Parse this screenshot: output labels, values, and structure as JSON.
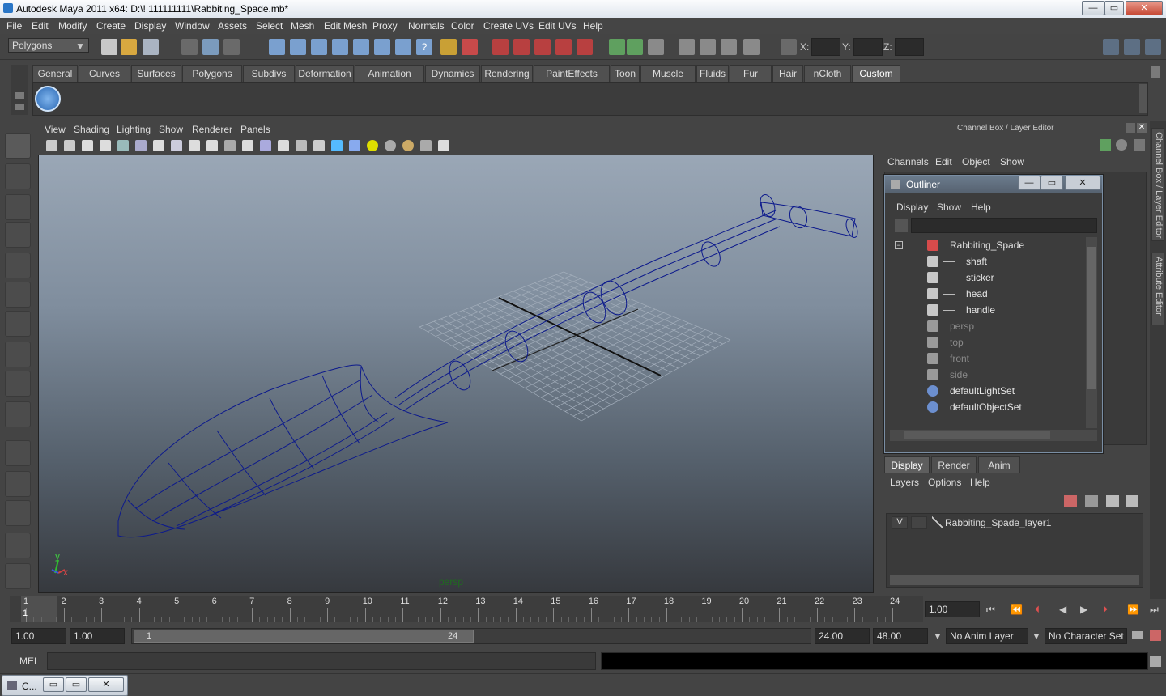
{
  "title": "Autodesk Maya 2011 x64: D:\\! 111111111\\Rabbiting_Spade.mb*",
  "window_buttons": {
    "min": "—",
    "max": "▭",
    "close": "✕"
  },
  "menus": [
    "File",
    "Edit",
    "Modify",
    "Create",
    "Display",
    "Window",
    "Assets",
    "Select",
    "Mesh",
    "Edit Mesh",
    "Proxy",
    "Normals",
    "Color",
    "Create UVs",
    "Edit UVs",
    "Help"
  ],
  "mode_select": "Polygons",
  "coords": {
    "x_label": "X:",
    "y_label": "Y:",
    "z_label": "Z:"
  },
  "shelf_tabs": [
    "General",
    "Curves",
    "Surfaces",
    "Polygons",
    "Subdivs",
    "Deformation",
    "Animation",
    "Dynamics",
    "Rendering",
    "PaintEffects",
    "Toon",
    "Muscle",
    "Fluids",
    "Fur",
    "Hair",
    "nCloth",
    "Custom"
  ],
  "active_shelf": "Custom",
  "viewport_menus": [
    "View",
    "Shading",
    "Lighting",
    "Show",
    "Renderer",
    "Panels"
  ],
  "camera_label": "persp",
  "axis": {
    "y": "y",
    "x": "x"
  },
  "channel_box": {
    "title": "Channel Box / Layer Editor",
    "menus": [
      "Channels",
      "Edit",
      "Object",
      "Show"
    ]
  },
  "outliner": {
    "title": "Outliner",
    "menus": [
      "Display",
      "Show",
      "Help"
    ],
    "items": [
      {
        "label": "Rabbiting_Spade",
        "indent": 0,
        "kind": "group"
      },
      {
        "label": "shaft",
        "indent": 1,
        "kind": "mesh"
      },
      {
        "label": "sticker",
        "indent": 1,
        "kind": "mesh"
      },
      {
        "label": "head",
        "indent": 1,
        "kind": "mesh"
      },
      {
        "label": "handle",
        "indent": 1,
        "kind": "mesh"
      },
      {
        "label": "persp",
        "indent": 0,
        "kind": "camera"
      },
      {
        "label": "top",
        "indent": 0,
        "kind": "camera"
      },
      {
        "label": "front",
        "indent": 0,
        "kind": "camera"
      },
      {
        "label": "side",
        "indent": 0,
        "kind": "camera"
      },
      {
        "label": "defaultLightSet",
        "indent": 0,
        "kind": "set"
      },
      {
        "label": "defaultObjectSet",
        "indent": 0,
        "kind": "set"
      }
    ]
  },
  "layer_editor": {
    "tabs": [
      "Display",
      "Render",
      "Anim"
    ],
    "menus": [
      "Layers",
      "Options",
      "Help"
    ],
    "layer": {
      "visible": "V",
      "name": "Rabbiting_Spade_layer1"
    }
  },
  "side_tabs": [
    "Channel Box / Layer Editor",
    "Attribute Editor"
  ],
  "timeline": {
    "ticks": [
      "1",
      "2",
      "3",
      "4",
      "5",
      "6",
      "7",
      "8",
      "9",
      "10",
      "11",
      "12",
      "13",
      "14",
      "15",
      "16",
      "17",
      "18",
      "19",
      "20",
      "21",
      "22",
      "23",
      "24"
    ],
    "current_marker": "1",
    "current_time": "1.00"
  },
  "range": {
    "start": "1.00",
    "start_inner": "1.00",
    "slider_start": "1",
    "slider_end": "24",
    "end_inner": "24.00",
    "end": "48.00",
    "anim_layer": "No Anim Layer",
    "character_set": "No Character Set"
  },
  "mel": {
    "label": "MEL"
  },
  "taskbar": {
    "item": "C..."
  },
  "colors": {
    "wireframe": "#0d1a8c",
    "grid": "#a3aebb",
    "accent": "#5e5e5e"
  }
}
